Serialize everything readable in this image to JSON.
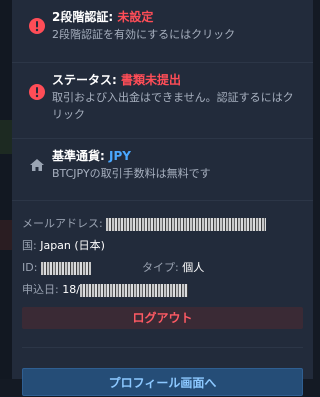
{
  "items": [
    {
      "icon": "alert-icon",
      "title_label": "2段階認証: ",
      "title_value": "未設定",
      "desc": "2段階認証を有効にするにはクリック"
    },
    {
      "icon": "alert-icon",
      "title_label": "ステータス: ",
      "title_value": "書類未提出",
      "desc": "取引および入出金はできません。認証するにはクリック"
    },
    {
      "icon": "home-icon",
      "title_label": "基準通貨: ",
      "title_value": "JPY",
      "desc": "BTCJPYの取引手数料は無料です"
    }
  ],
  "info": {
    "email_label": "メールアドレス: ",
    "country_label": "国: ",
    "country_value": "Japan (日本)",
    "id_label": "ID: ",
    "type_label": "タイプ: ",
    "type_value": "個人",
    "applied_label": "申込日: ",
    "applied_value_prefix": "18/"
  },
  "actions": {
    "logout_label": "ログアウト",
    "profile_label": "プロフィール画面へ"
  },
  "colors": {
    "panel_bg": "#222b3b",
    "alert_red": "#ff4d57",
    "accent_blue": "#4aa8ff",
    "profile_button": "#254d77"
  }
}
